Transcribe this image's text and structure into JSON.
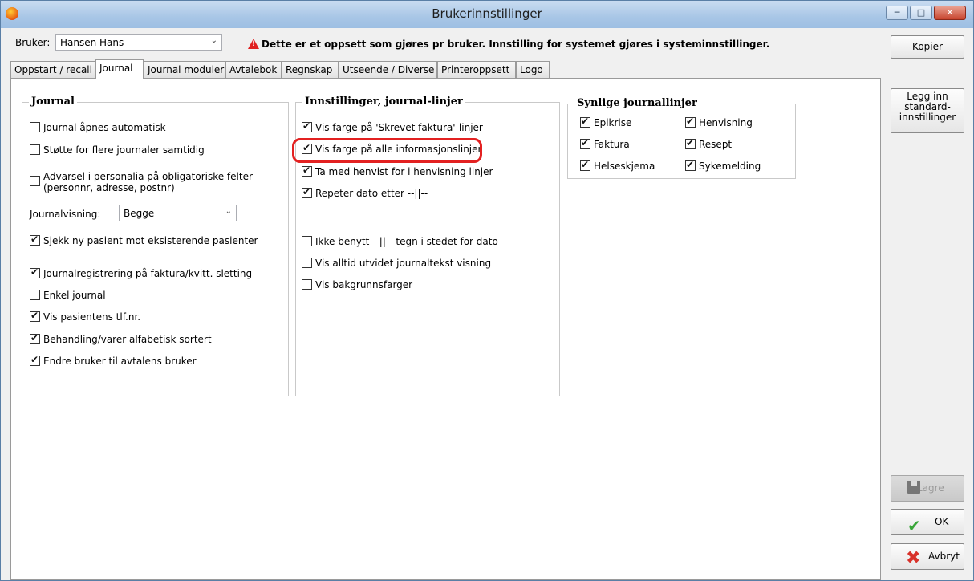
{
  "window": {
    "title": "Brukerinnstillinger"
  },
  "user": {
    "label": "Bruker:",
    "value": "Hansen Hans"
  },
  "warning": "Dette er et oppsett som gjøres pr bruker. Innstilling for systemet gjøres i systeminnstillinger.",
  "tabs": [
    "Oppstart / recall",
    "Journal",
    "Journal moduler",
    "Avtalebok",
    "Regnskap",
    "Utseende / Diverse",
    "Printeroppsett",
    "Logo"
  ],
  "active_tab": "Journal",
  "journal": {
    "title": "Journal",
    "auto_open": {
      "label": "Journal åpnes automatisk",
      "checked": false
    },
    "multi": {
      "label": "Støtte for flere journaler samtidig",
      "checked": false
    },
    "warn_line1": "Advarsel i personalia på obligatoriske  felter",
    "warn_line2": "(personnr, adresse, postnr)",
    "warn_checked": false,
    "view_label": "Journalvisning:",
    "view_value": "Begge",
    "check_patient": {
      "label": "Sjekk ny pasient mot eksisterende pasienter",
      "checked": true
    },
    "registration": {
      "label": "Journalregistrering på faktura/kvitt. sletting",
      "checked": true
    },
    "simple": {
      "label": "Enkel journal",
      "checked": false
    },
    "phone": {
      "label": "Vis pasientens tlf.nr.",
      "checked": true
    },
    "sorted": {
      "label": "Behandling/varer alfabetisk sortert",
      "checked": true
    },
    "change_user": {
      "label": "Endre bruker til avtalens bruker",
      "checked": true
    }
  },
  "lines": {
    "title": "Innstillinger, journal-linjer",
    "invoice_color": {
      "label": "Vis farge på 'Skrevet faktura'-linjer",
      "checked": true
    },
    "info_color": {
      "label": "Vis farge på alle informasjonslinjer",
      "checked": true
    },
    "referred": {
      "label": "Ta med henvist for i henvisning linjer",
      "checked": true
    },
    "repeat_date": {
      "label": "Repeter dato etter --||--",
      "checked": true
    },
    "no_use": {
      "label": "Ikke benytt --||-- tegn i stedet for dato",
      "checked": false
    },
    "expanded": {
      "label": "Vis alltid utvidet journaltekst visning",
      "checked": false
    },
    "bg_colors": {
      "label": "Vis bakgrunnsfarger",
      "checked": false
    }
  },
  "visible": {
    "title": "Synlige journallinjer",
    "epikrise": {
      "label": "Epikrise",
      "checked": true
    },
    "henvisning": {
      "label": "Henvisning",
      "checked": true
    },
    "faktura": {
      "label": "Faktura",
      "checked": true
    },
    "resept": {
      "label": "Resept",
      "checked": true
    },
    "helseskjema": {
      "label": "Helseskjema",
      "checked": true
    },
    "sykemelding": {
      "label": "Sykemelding",
      "checked": true
    }
  },
  "buttons": {
    "copy": "Kopier",
    "defaults": "Legg inn standard-innstillinger",
    "save": "Lagre",
    "ok": "OK",
    "cancel": "Avbryt"
  },
  "colors": {
    "highlight": "#e32121",
    "warning_icon": "#e02020"
  }
}
